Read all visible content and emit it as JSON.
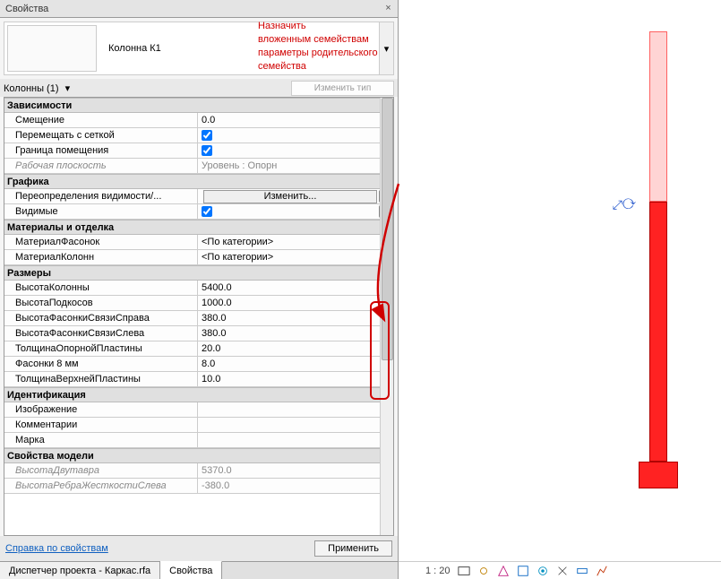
{
  "panel": {
    "title": "Свойства",
    "type_name": "Колонна К1",
    "instance_filter": "Колонны (1)",
    "edit_type": "Изменить тип",
    "help": "Справка по свойствам",
    "apply": "Применить"
  },
  "groups": [
    {
      "name": "Зависимости",
      "params": [
        {
          "name": "Смещение",
          "value": "0.0",
          "assoc": false,
          "readonly": false,
          "type": "text"
        },
        {
          "name": "Перемещать с сеткой",
          "value": "true",
          "assoc": false,
          "readonly": false,
          "type": "check"
        },
        {
          "name": "Граница помещения",
          "value": "true",
          "assoc": false,
          "readonly": false,
          "type": "check"
        },
        {
          "name": "Рабочая плоскость",
          "value": "Уровень : Опорн",
          "assoc": false,
          "readonly": true,
          "type": "text"
        }
      ]
    },
    {
      "name": "Графика",
      "params": [
        {
          "name": "Переопределения видимости/...",
          "value": "Изменить...",
          "assoc": true,
          "readonly": false,
          "type": "button"
        },
        {
          "name": "Видимые",
          "value": "true",
          "assoc": true,
          "readonly": false,
          "type": "check"
        }
      ]
    },
    {
      "name": "Материалы и отделка",
      "params": [
        {
          "name": "МатериалФасонок",
          "value": "<По категории>",
          "assoc": true,
          "readonly": false,
          "type": "text"
        },
        {
          "name": "МатериалКолонн",
          "value": "<По категории>",
          "assoc": true,
          "readonly": false,
          "type": "text"
        }
      ]
    },
    {
      "name": "Размеры",
      "params": [
        {
          "name": "ВысотаКолонны",
          "value": "5400.0",
          "assoc": true,
          "readonly": false,
          "type": "text"
        },
        {
          "name": "ВысотаПодкосов",
          "value": "1000.0",
          "assoc": true,
          "readonly": false,
          "type": "text"
        },
        {
          "name": "ВысотаФасонкиСвязиСправа",
          "value": "380.0",
          "assoc": true,
          "readonly": false,
          "type": "text"
        },
        {
          "name": "ВысотаФасонкиСвязиСлева",
          "value": "380.0",
          "assoc": true,
          "readonly": false,
          "type": "text"
        },
        {
          "name": "ТолщинаОпорнойПластины",
          "value": "20.0",
          "assoc": true,
          "readonly": false,
          "type": "text"
        },
        {
          "name": "Фасонки 8 мм",
          "value": "8.0",
          "assoc": true,
          "readonly": false,
          "type": "text"
        },
        {
          "name": "ТолщинаВерхнейПластины",
          "value": "10.0",
          "assoc": true,
          "readonly": false,
          "type": "text"
        }
      ]
    },
    {
      "name": "Идентификация",
      "params": [
        {
          "name": "Изображение",
          "value": "",
          "assoc": false,
          "readonly": false,
          "type": "text"
        },
        {
          "name": "Комментарии",
          "value": "",
          "assoc": true,
          "readonly": false,
          "type": "text"
        },
        {
          "name": "Марка",
          "value": "",
          "assoc": true,
          "readonly": false,
          "type": "text"
        }
      ]
    },
    {
      "name": "Свойства модели",
      "params": [
        {
          "name": "ВысотаДвутавра",
          "value": "5370.0",
          "assoc": false,
          "readonly": true,
          "type": "text"
        },
        {
          "name": "ВысотаРебраЖесткостиСлева",
          "value": "-380.0",
          "assoc": false,
          "readonly": true,
          "type": "text"
        }
      ]
    }
  ],
  "tabs": {
    "project_browser": "Диспетчер проекта - Каркас.rfa",
    "properties": "Свойства"
  },
  "status": {
    "scale": "1 : 20"
  },
  "annotation": {
    "line1": "Назначить",
    "line2": "вложенным семействам",
    "line3": "параметры родительского",
    "line4": "семейства"
  },
  "icons": {
    "close": "×",
    "chevron": "▾",
    "caret": "⌃"
  }
}
